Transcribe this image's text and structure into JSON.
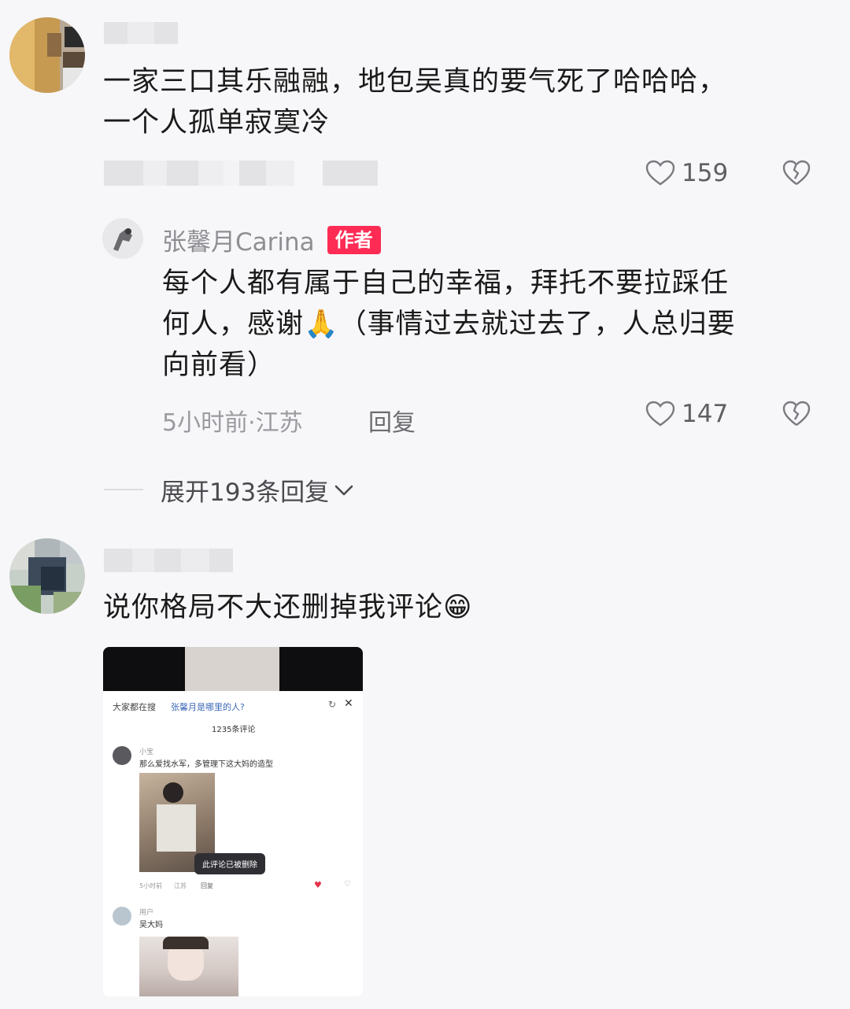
{
  "comment1": {
    "text_line1": "一家三口其乐融融，地包吴真的要气死了哈哈哈，",
    "text_line2": "一个人孤单寂寞冷",
    "likes": "159"
  },
  "reply": {
    "username": "张馨月Carina",
    "badge": "作者",
    "text_line1": "每个人都有属于自己的幸福，拜托不要拉踩任",
    "text_line2a": "何人，感谢",
    "emoji": "🙏",
    "text_line2b": "（事情过去就过去了，人总归要",
    "text_line3": "向前看）",
    "meta": "5小时前·江苏",
    "reply_label": "回复",
    "likes": "147"
  },
  "expand": {
    "label": "展开193条回复"
  },
  "comment2": {
    "text": "说你格局不大还删掉我评论",
    "emoji": "😁"
  },
  "screenshot": {
    "header_left": "大家都在搜",
    "header_link": "张馨月是哪里的人?",
    "count": "1235条评论",
    "c1_name": "小宝",
    "c1_text": "那么爱找水军，多管理下这大妈的造型",
    "toast": "此评论已被删除",
    "c1_meta_time": "5小时前",
    "c1_meta_loc": "江苏",
    "c1_reply": "回复",
    "c2_name": "用户",
    "c2_text": "吴大妈"
  }
}
